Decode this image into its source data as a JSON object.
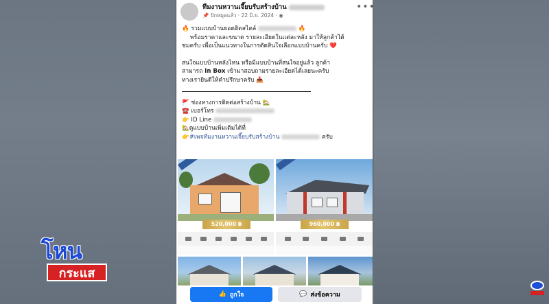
{
  "post": {
    "page_name": "ทีมงานหวานเจี๊ยบรับสร้างบ้าน",
    "meta_prefix": "📌 ปักหมุดแล้ว · 22 มิ.ย. 2024 ·",
    "more_icon": "more-dots-icon",
    "lines": {
      "l1_pre": "🔥 รวมแบบบ้านยอดฮิตสไตล์",
      "l1_post": "🔥",
      "l2": "พร้อมราคาและขนาด รายละเอียดในแต่ละหลัง มาให้ลูกค้าได้",
      "l3": "ชมครับ เพื่อเป็นแนวทางในการตัดสินใจเลือกแบบบ้านครับ ❤️",
      "l4": "สนใจแบบบ้านหลังไหน หรือมีแบบบ้านที่สนใจอยู่แล้ว ลูกค้า",
      "l5_pre": "สามารถ",
      "l5_bold": "In Box",
      "l5_post": "เข้ามาสอบถามรายละเอียดได้เลยนะครับ",
      "l6": "ทางเรายินดีให้คำปรึกษาครับ 📥",
      "c1": "🚩 ช่องทางการติดต่อสร้างบ้าน 🏡",
      "c2": "☎️ เบอร์โทร",
      "c3": "👉 ID Line",
      "c4": "🏡ดูแบบบ้านเพิ่มเติมได้ที่",
      "c5_hashtag": "👉#เพจทีมงานหวานเจี๊ยบรับสร้างบ้าน",
      "c5_post": "ครับ"
    },
    "images": [
      {
        "price": "520,000 ฿"
      },
      {
        "price": "960,000 ฿"
      }
    ],
    "actions": {
      "like_label": "ถูกใจ",
      "message_label": "ส่งข้อความ"
    }
  },
  "overlay": {
    "show_logo_top": "โหน",
    "show_logo_bottom": "กระแส"
  },
  "colors": {
    "facebook_blue": "#1877f2",
    "price_gold": "#d4b05a",
    "show_logo_blue": "#1b48d6",
    "show_logo_red": "#d62222"
  }
}
